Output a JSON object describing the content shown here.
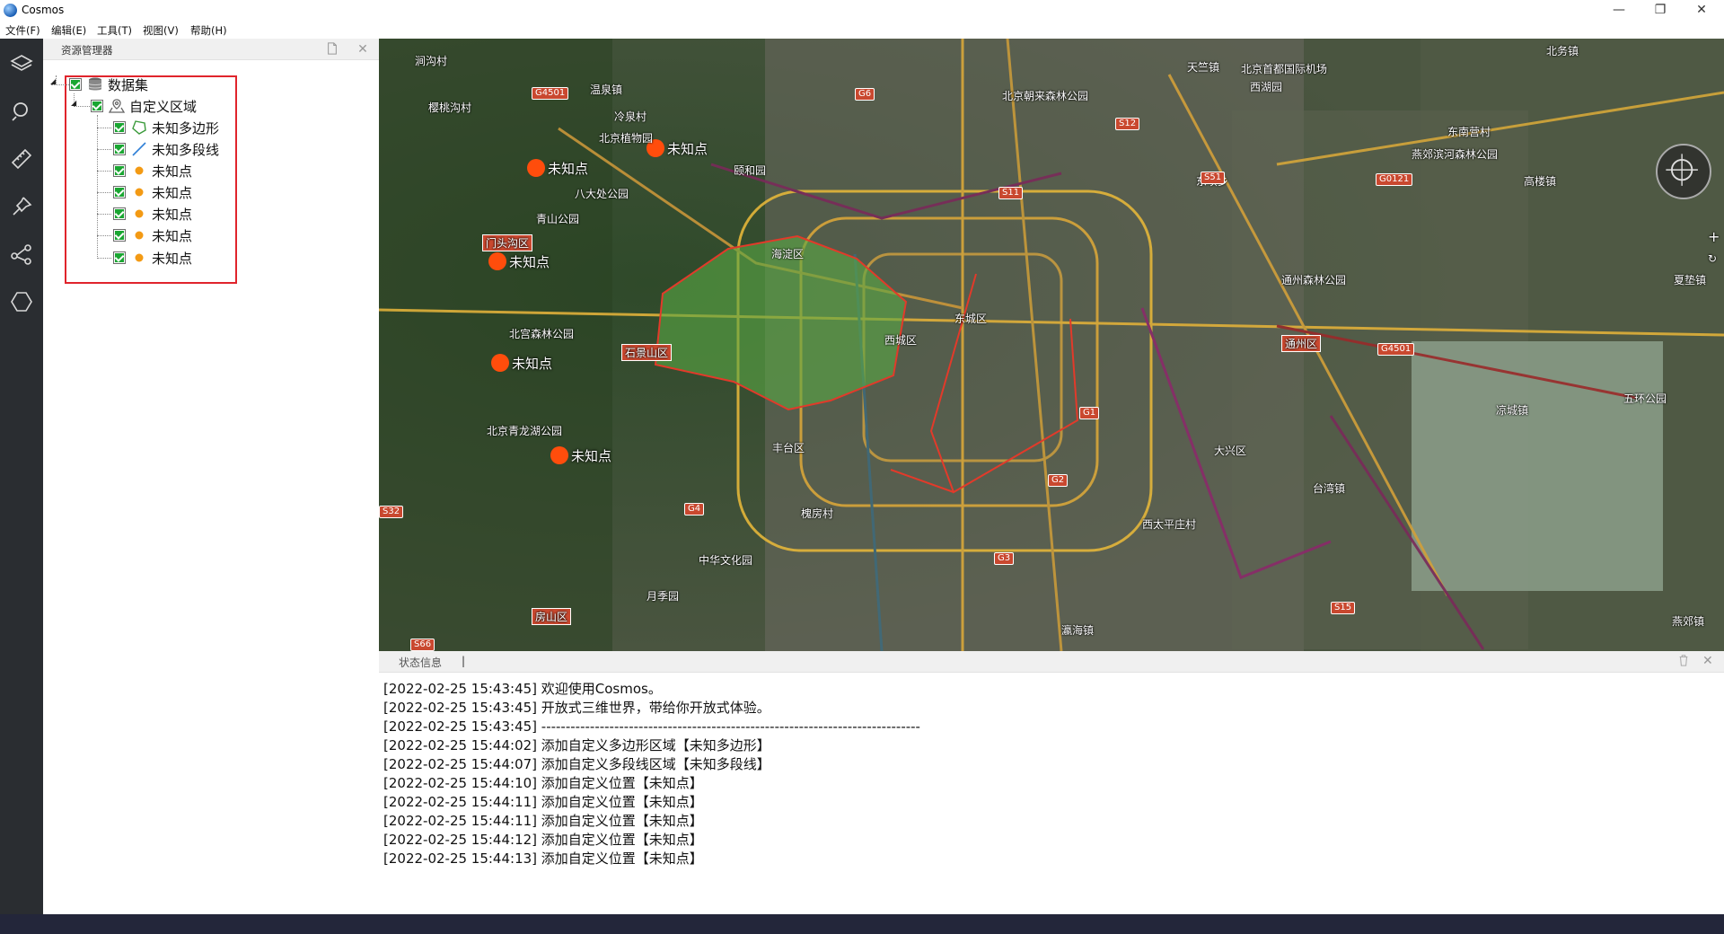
{
  "app": {
    "title": "Cosmos"
  },
  "window_controls": {
    "minimize": "—",
    "restore": "❐",
    "close": "✕"
  },
  "menu": [
    "文件(F)",
    "编辑(E)",
    "工具(T)",
    "视图(V)",
    "帮助(H)"
  ],
  "sidebar_icons": [
    "layers-icon",
    "search-icon",
    "ruler-icon",
    "pin-icon",
    "share-icon",
    "hexagon-icon"
  ],
  "resource_panel": {
    "title": "资源管理器",
    "tree": {
      "root": {
        "label": "数据集",
        "icon": "database-icon",
        "checked": true
      },
      "group": {
        "label": "自定义区域",
        "icon": "map-pin-icon",
        "checked": true
      },
      "items": [
        {
          "label": "未知多边形",
          "icon": "polygon-icon",
          "checked": true
        },
        {
          "label": "未知多段线",
          "icon": "polyline-icon",
          "checked": true
        },
        {
          "label": "未知点",
          "icon": "point-icon",
          "checked": true
        },
        {
          "label": "未知点",
          "icon": "point-icon",
          "checked": true
        },
        {
          "label": "未知点",
          "icon": "point-icon",
          "checked": true
        },
        {
          "label": "未知点",
          "icon": "point-icon",
          "checked": true
        },
        {
          "label": "未知点",
          "icon": "point-icon",
          "checked": true
        }
      ]
    }
  },
  "map": {
    "points": [
      {
        "label": "未知点"
      },
      {
        "label": "未知点"
      },
      {
        "label": "未知点"
      },
      {
        "label": "未知点"
      },
      {
        "label": "未知点"
      }
    ],
    "place_labels": [
      "涧沟村",
      "温泉镇",
      "樱桃沟村",
      "冷泉村",
      "北京植物园",
      "八大处公园",
      "青山公园",
      "门头沟区",
      "石景山区",
      "北宫森林公园",
      "北京青龙湖公园",
      "房山区",
      "月季园",
      "中华文化园",
      "槐房村",
      "颐和园",
      "海淀区",
      "西城区",
      "东城区",
      "丰台区",
      "北京朝来森林公园",
      "天竺镇",
      "北京首都国际机场",
      "西湖园",
      "东坝乡",
      "通州区",
      "通州森林公园",
      "燕郊滨河森林公园",
      "高楼镇",
      "东南营村",
      "北务镇",
      "大兴区",
      "西太平庄村",
      "台湾镇",
      "五环公园",
      "凉城镇",
      "瀛海镇",
      "夏垫镇",
      "燕郊镇"
    ],
    "road_badges": [
      "G6",
      "G4501",
      "S12",
      "S11",
      "S51",
      "G0121",
      "G1",
      "G2",
      "G3",
      "G4",
      "S15",
      "S32",
      "S66",
      "G4501"
    ],
    "polygon_color": "#5aa845",
    "polyline_color": "#e23a2a",
    "point_color": "#ff4d0c"
  },
  "status_panel": {
    "title": "状态信息",
    "log": [
      "[2022-02-25 15:43:45] 欢迎使用Cosmos。",
      "[2022-02-25 15:43:45] 开放式三维世界，带给你开放式体验。",
      "[2022-02-25 15:43:45] ------------------------------------------------------------------------------",
      "[2022-02-25 15:44:02] 添加自定义多边形区域【未知多边形】",
      "[2022-02-25 15:44:07] 添加自定义多段线区域【未知多段线】",
      "[2022-02-25 15:44:10] 添加自定义位置【未知点】",
      "[2022-02-25 15:44:11] 添加自定义位置【未知点】",
      "[2022-02-25 15:44:11] 添加自定义位置【未知点】",
      "[2022-02-25 15:44:12] 添加自定义位置【未知点】",
      "[2022-02-25 15:44:13] 添加自定义位置【未知点】"
    ]
  }
}
